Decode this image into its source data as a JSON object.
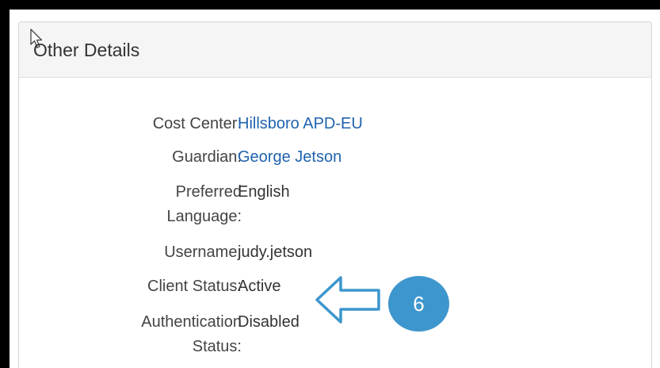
{
  "panel": {
    "title": "Other Details"
  },
  "fields": [
    {
      "label": "Cost Center:",
      "value": "Hillsboro APD-EU"
    },
    {
      "label": "Guardian:",
      "value": "George Jetson"
    },
    {
      "label_line1": "Preferred",
      "label_line2": "Language:",
      "value": "English"
    },
    {
      "label": "Username:",
      "value": "judy.jetson"
    },
    {
      "label": "Client Status:",
      "value": "Active"
    },
    {
      "label_line1": "Authentication",
      "label_line2": "Status:",
      "value": "Disabled"
    }
  ],
  "annotation": {
    "step_number": "6",
    "arrow_icon": "arrow-left-outline-icon",
    "color": "#3d96cd"
  },
  "colors": {
    "link": "#1f63ae",
    "header_bg": "#f5f5f5",
    "frame": "#000000"
  }
}
